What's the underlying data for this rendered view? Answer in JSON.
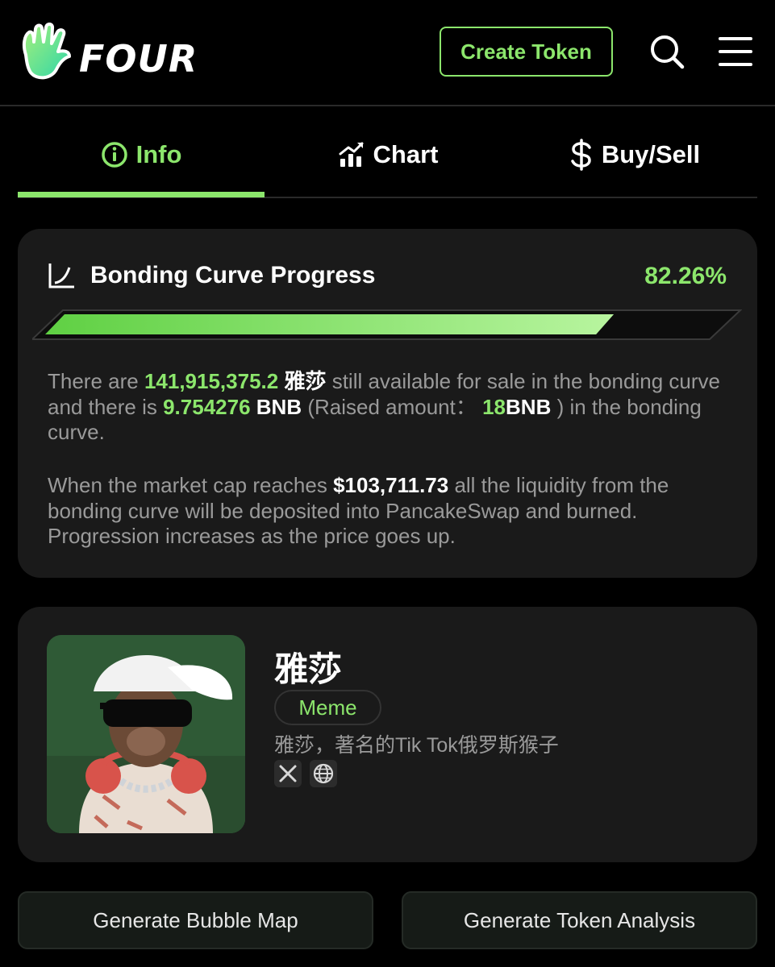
{
  "header": {
    "logo_text": "FOUR",
    "create_token_label": "Create Token"
  },
  "tabs": [
    {
      "label": "Info",
      "icon": "info-icon",
      "active": true
    },
    {
      "label": "Chart",
      "icon": "chart-icon",
      "active": false
    },
    {
      "label": "Buy/Sell",
      "icon": "dollar-icon",
      "active": false
    }
  ],
  "bonding": {
    "title": "Bonding Curve Progress",
    "percent_label": "82.26%",
    "progress": 0.8226,
    "line1_a": "There are ",
    "available_amount": "141,915,375.2",
    "line1_b": " 雅莎",
    "line1_c": " still available for sale in the bonding curve and there is ",
    "bnb_amount": "9.754276",
    "line1_d": " BNB",
    "line1_e": " (Raised amount：  ",
    "raised_amount": "18",
    "line1_f": "BNB",
    "line1_g": " ) in the bonding curve.",
    "line2_a": "When the market cap reaches ",
    "market_cap": "$103,711.73",
    "line2_b": " all the liquidity from the bonding curve will be deposited into PancakeSwap and burned. Progression increases as the price goes up."
  },
  "token": {
    "name": "雅莎",
    "tag": "Meme",
    "description": "雅莎，著名的Tik Tok俄罗斯猴子",
    "socials": [
      "x-icon",
      "globe-icon"
    ]
  },
  "actions": {
    "bubble_map_label": "Generate Bubble Map",
    "token_analysis_label": "Generate Token Analysis"
  },
  "colors": {
    "accent": "#8ce66c",
    "background": "#000000",
    "card": "#1a1a1a"
  }
}
